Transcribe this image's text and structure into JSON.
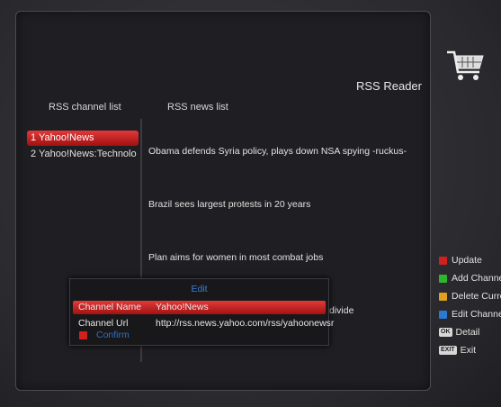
{
  "title": "RSS Reader",
  "columns": {
    "channels_header": "RSS channel list",
    "news_header": "RSS news list"
  },
  "channels": [
    {
      "label": "1  Yahoo!News",
      "selected": true
    },
    {
      "label": "2  Yahoo!News:Technolo",
      "selected": false
    }
  ],
  "news": [
    "Obama defends Syria policy, plays down NSA spying -ruckus-",
    "Brazil sees largest protests in 20 years",
    "Plan aims for women in most combat jobs",
    "divide"
  ],
  "legend": [
    {
      "label": "Update",
      "color": "#d41f1f",
      "icon": "red-key"
    },
    {
      "label": "Add Channel",
      "color": "#2fb52f",
      "icon": "green-key"
    },
    {
      "label": "Delete Curren",
      "color": "#e0a020",
      "icon": "yellow-key"
    },
    {
      "label": "Edit Channel",
      "color": "#2a79d6",
      "icon": "blue-key"
    },
    {
      "label": "Detail",
      "key": "OK",
      "icon": "ok-key"
    },
    {
      "label": "Exit",
      "key": "EXIT",
      "icon": "exit-key"
    }
  ],
  "dialog": {
    "title": "Edit",
    "rows": [
      {
        "label": "Channel Name",
        "value": "Yahoo!News",
        "selected": true
      },
      {
        "label": "Channel Url",
        "value": "http://rss.news.yahoo.com/rss/yahoonewsr",
        "selected": false
      }
    ],
    "confirm": "Confirm"
  }
}
